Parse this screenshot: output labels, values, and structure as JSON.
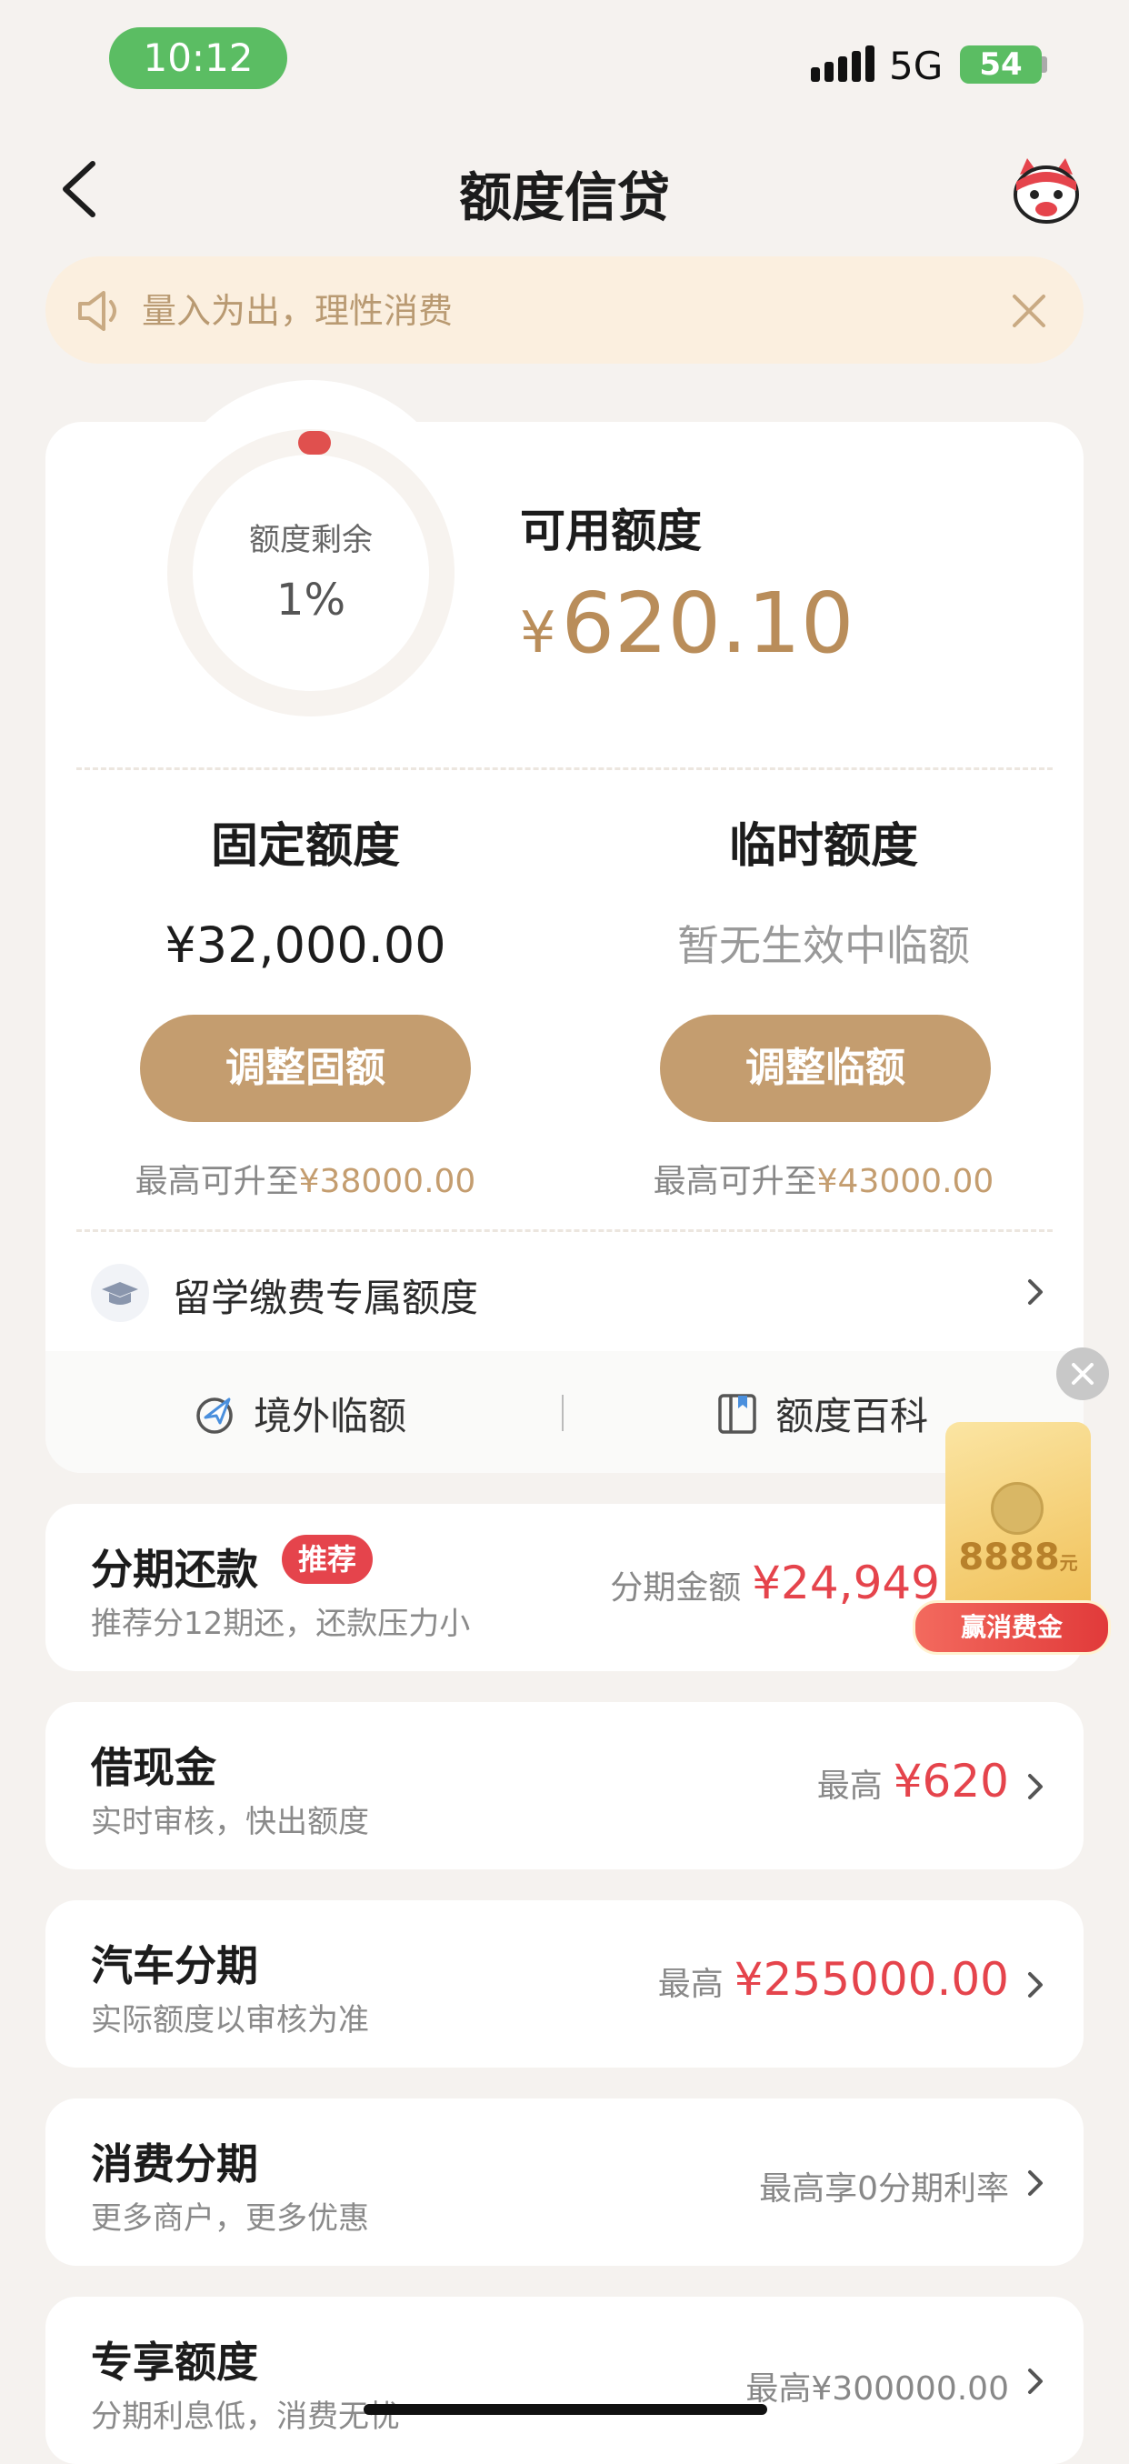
{
  "status_bar": {
    "time": "10:12",
    "network": "5G",
    "battery": "54"
  },
  "nav": {
    "title": "额度信贷"
  },
  "notice": {
    "text": "量入为出，理性消费"
  },
  "credit": {
    "ring_label": "额度剩余",
    "ring_percent": "1%",
    "ring_fraction": 0.01,
    "available_label": "可用额度",
    "available_currency": "¥",
    "available_value": "620.10",
    "fixed": {
      "title": "固定额度",
      "value": "¥32,000.00",
      "button": "调整固额",
      "max_prefix": "最高可升至",
      "max_amount": "¥38000.00"
    },
    "temporary": {
      "title": "临时额度",
      "status": "暂无生效中临额",
      "button": "调整临额",
      "max_prefix": "最高可升至",
      "max_amount": "¥43000.00"
    },
    "study_abroad": "留学缴费专属额度",
    "overseas": "境外临额",
    "encyclopedia": "额度百科"
  },
  "list": [
    {
      "title": "分期还款",
      "badge": "推荐",
      "subtitle": "推荐分12期还，还款压力小",
      "right_label": "分期金额",
      "right_amount": "¥24,949"
    },
    {
      "title": "借现金",
      "subtitle": "实时审核，快出额度",
      "right_label": "最高",
      "right_amount": "¥620"
    },
    {
      "title": "汽车分期",
      "subtitle": "实际额度以审核为准",
      "right_label": "最高",
      "right_amount": "¥255000.00"
    },
    {
      "title": "消费分期",
      "subtitle": "更多商户，更多优惠",
      "right_label": "最高享0分期利率",
      "right_amount": ""
    },
    {
      "title": "专享额度",
      "subtitle": "分期利息低，消费无忧",
      "right_label": "最高¥300000.00",
      "right_amount": ""
    }
  ],
  "promo": {
    "amount": "8888",
    "unit": "元",
    "button": "赢消费金"
  },
  "colors": {
    "accent": "#c49d6f",
    "amount_red": "#e5444c",
    "time_pill": "#5bbd63"
  }
}
